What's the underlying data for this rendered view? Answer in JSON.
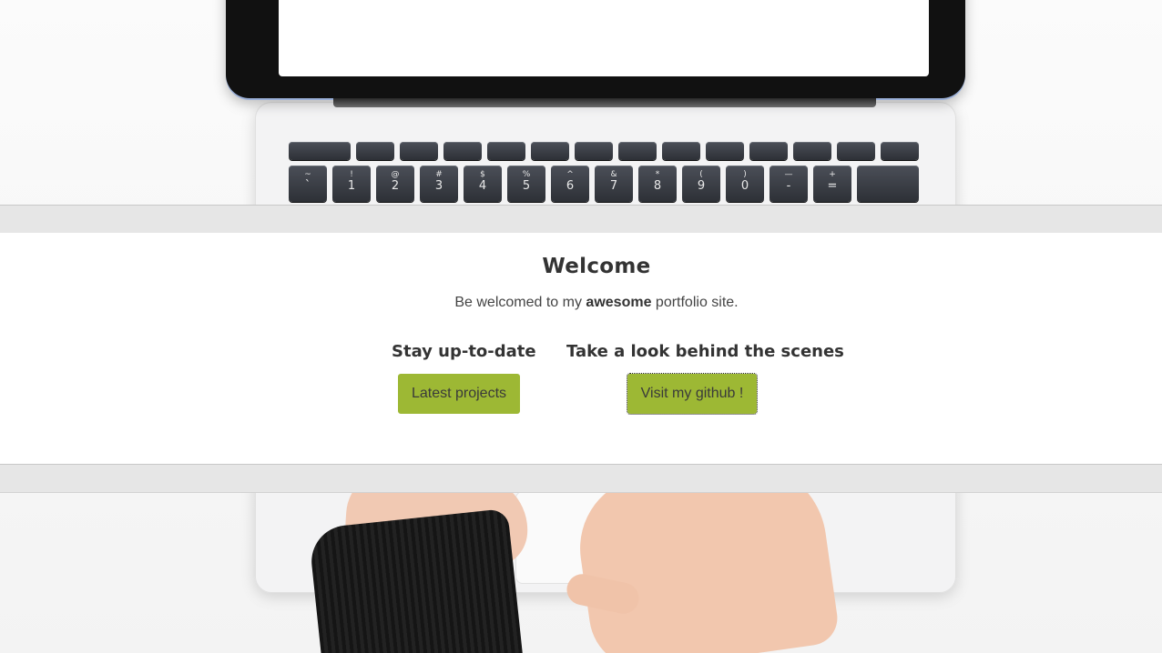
{
  "welcome": {
    "title": "Welcome",
    "intro_before": "Be welcomed to my ",
    "intro_bold": "awesome",
    "intro_after": " portfolio site."
  },
  "columns": [
    {
      "heading": "Stay up-to-date",
      "button_label": "Latest projects"
    },
    {
      "heading": "Take a look behind the scenes",
      "button_label": "Visit my github !"
    }
  ],
  "keyboard": {
    "top_row": [
      "~\n`",
      "!\n1",
      "@\n2",
      "#\n3",
      "$\n4",
      "%\n5",
      "^\n6",
      "&\n7",
      "*\n8",
      "(\n9",
      ")\n0",
      "—\n-",
      "+\n="
    ]
  },
  "colors": {
    "accent": "#9db834",
    "band": "#e6e6e6",
    "text": "#333333"
  }
}
